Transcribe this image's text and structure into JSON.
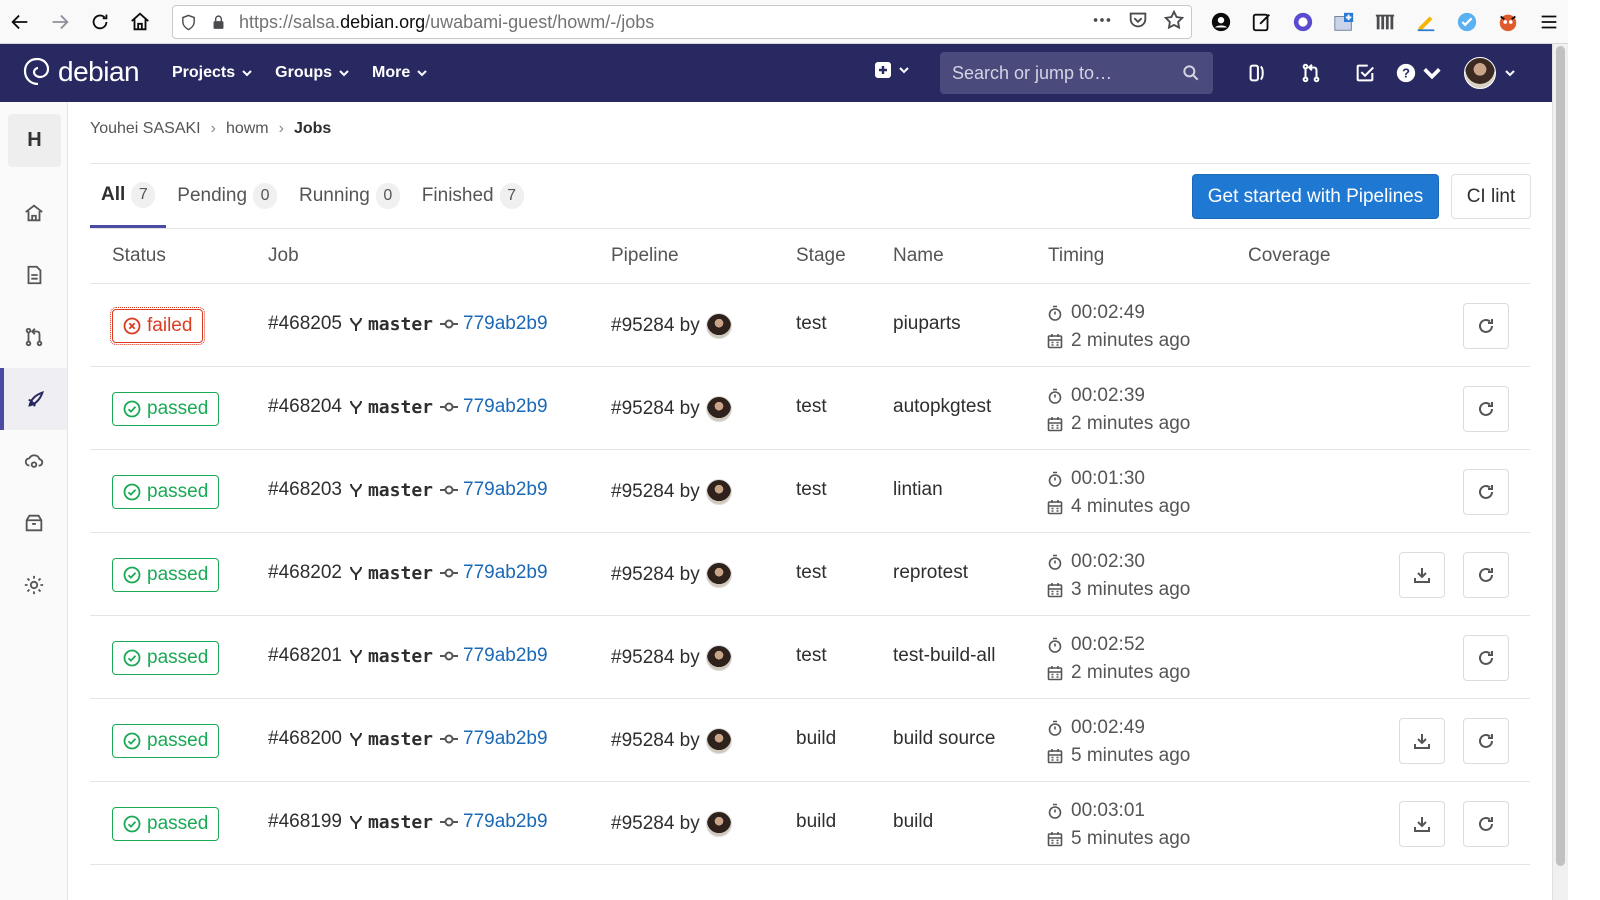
{
  "browser": {
    "url_prefix": "https://salsa.",
    "url_domain": "debian.org",
    "url_path": "/uwabami-guest/howm/-/jobs"
  },
  "header": {
    "logo_text": "debian",
    "nav": [
      "Projects",
      "Groups",
      "More"
    ],
    "search_placeholder": "Search or jump to…"
  },
  "sidebar": {
    "project_letter": "H",
    "items": [
      "home-icon",
      "repository-icon",
      "merge-requests-icon",
      "ci-cd-icon",
      "operations-icon",
      "packages-icon",
      "settings-icon"
    ],
    "active_index": 3
  },
  "breadcrumb": [
    "Youhei SASAKI",
    "howm",
    "Jobs"
  ],
  "tabs": [
    {
      "label": "All",
      "count": "7"
    },
    {
      "label": "Pending",
      "count": "0"
    },
    {
      "label": "Running",
      "count": "0"
    },
    {
      "label": "Finished",
      "count": "7"
    }
  ],
  "buttons": {
    "pipelines": "Get started with Pipelines",
    "ci_lint": "CI lint"
  },
  "table": {
    "headers": [
      "Status",
      "Job",
      "Pipeline",
      "Stage",
      "Name",
      "Timing",
      "Coverage"
    ],
    "rows": [
      {
        "status": "failed",
        "job": "#468205",
        "ref": "master",
        "sha": "779ab2b9",
        "pipeline": "#95284 by",
        "stage": "test",
        "name": "piuparts",
        "duration": "00:02:49",
        "ago": "2 minutes ago"
      },
      {
        "status": "passed",
        "job": "#468204",
        "ref": "master",
        "sha": "779ab2b9",
        "pipeline": "#95284 by",
        "stage": "test",
        "name": "autopkgtest",
        "duration": "00:02:39",
        "ago": "2 minutes ago"
      },
      {
        "status": "passed",
        "job": "#468203",
        "ref": "master",
        "sha": "779ab2b9",
        "pipeline": "#95284 by",
        "stage": "test",
        "name": "lintian",
        "duration": "00:01:30",
        "ago": "4 minutes ago"
      },
      {
        "status": "passed",
        "job": "#468202",
        "ref": "master",
        "sha": "779ab2b9",
        "pipeline": "#95284 by",
        "stage": "test",
        "name": "reprotest",
        "duration": "00:02:30",
        "ago": "3 minutes ago"
      },
      {
        "status": "passed",
        "job": "#468201",
        "ref": "master",
        "sha": "779ab2b9",
        "pipeline": "#95284 by",
        "stage": "test",
        "name": "test-build-all",
        "duration": "00:02:52",
        "ago": "2 minutes ago"
      },
      {
        "status": "passed",
        "job": "#468200",
        "ref": "master",
        "sha": "779ab2b9",
        "pipeline": "#95284 by",
        "stage": "build",
        "name": "build source",
        "duration": "00:02:49",
        "ago": "5 minutes ago"
      },
      {
        "status": "passed",
        "job": "#468199",
        "ref": "master",
        "sha": "779ab2b9",
        "pipeline": "#95284 by",
        "stage": "build",
        "name": "build",
        "duration": "00:03:01",
        "ago": "5 minutes ago"
      }
    ]
  },
  "colors": {
    "header_bg": "#292961",
    "passed": "#1aaa55",
    "failed": "#db3b21",
    "primary": "#1f78d1",
    "link": "#1b69b6"
  }
}
